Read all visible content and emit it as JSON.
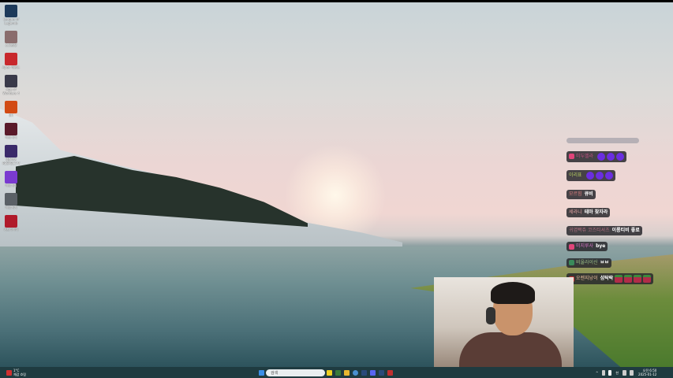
{
  "desktop_icons": [
    {
      "label": "League of Legends",
      "color": "#1d3a5a"
    },
    {
      "label": "스크린샷",
      "color": "#8a6d6d"
    },
    {
      "label": "Apex 레전드",
      "color": "#c8282c"
    },
    {
      "label": "Age of Wonders 4",
      "color": "#3a3a4a"
    },
    {
      "label": "9H",
      "color": "#d24a14"
    },
    {
      "label": "바로가기",
      "color": "#5a1a2a"
    },
    {
      "label": "DJMAX RESPECT V",
      "color": "#3a2a6a"
    },
    {
      "label": "바로가기",
      "color": "#7a3ad0"
    },
    {
      "label": "바로가기",
      "color": "#5a6066"
    },
    {
      "label": "카트라이더",
      "color": "#b01a2a"
    }
  ],
  "chat": {
    "messages": [
      {
        "nick": "미두벨라",
        "nick_color": "#c05080",
        "badge": "#e0457a",
        "text": "",
        "emotes": 3,
        "emote": "purple"
      },
      {
        "nick": "이리표",
        "nick_color": "#b8d060",
        "badge": "",
        "text": "",
        "emotes": 3,
        "emote": "purple"
      },
      {
        "nick": "모르힘",
        "nick_color": "#e08080",
        "badge": "",
        "text": "큐비",
        "emotes": 0
      },
      {
        "nick": "세라니",
        "nick_color": "#e0a0a0",
        "badge": "",
        "text": "테마 찾자라",
        "emotes": 0
      },
      {
        "nick": "귀엽빡쥬 코즈티셔츠",
        "nick_color": "#b07080",
        "badge": "",
        "text": "이롱티비 좋료",
        "emotes": 0
      },
      {
        "nick": "미지루사",
        "nick_color": "#d070c0",
        "badge": "#e0457a",
        "text": "bye",
        "emotes": 0
      },
      {
        "nick": "비울라이신",
        "nick_color": "#a0c080",
        "badge": "#3a8a5a",
        "text": "ㅂㅂ",
        "emotes": 0
      },
      {
        "nick": "오렌지낭이",
        "nick_color": "#f0c0a0",
        "badge": "#d03030",
        "text": "섬탁락",
        "emotes": 4,
        "emote": "green"
      }
    ]
  },
  "taskbar": {
    "weather_temp": "1°C",
    "weather_desc": "체감 흐림",
    "search_placeholder": "검색",
    "clock_time": "오전 6:50",
    "clock_date": "2025-01-12",
    "ime": "한"
  }
}
